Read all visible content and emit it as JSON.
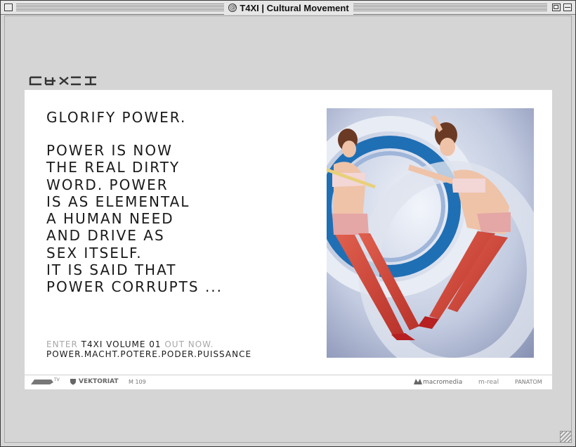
{
  "window": {
    "title": "T4XI | Cultural Movement"
  },
  "brand": {
    "logo_text": "T4XI"
  },
  "headline": "GLORIFY POWER.",
  "body_lines": [
    "POWER IS NOW",
    "THE REAL DIRTY",
    "WORD. POWER",
    "IS AS ELEMENTAL",
    "A HUMAN NEED",
    "AND DRIVE AS",
    "SEX ITSELF.",
    "IT IS SAID THAT",
    "POWER CORRUPTS ..."
  ],
  "enter": {
    "prefix": "ENTER",
    "link": "T4XI VOLUME 01",
    "suffix": "OUT NOW."
  },
  "languages": "POWER.MACHT.POTERE.PODER.PUISSANCE",
  "footer": {
    "left": [
      {
        "label": "TV"
      },
      {
        "label": "VEKTORIAT"
      },
      {
        "label": "M 109"
      }
    ],
    "right": [
      {
        "label": "macromedia"
      },
      {
        "label": "m-real"
      },
      {
        "label": "PANATOM"
      }
    ]
  },
  "colors": {
    "text": "#1a1a1a",
    "dim_text": "#a8a8a8",
    "panel": "#ffffff",
    "background": "#d5d5d5",
    "accent_blue": "#1f6fb5",
    "accent_red": "#d9272e"
  }
}
